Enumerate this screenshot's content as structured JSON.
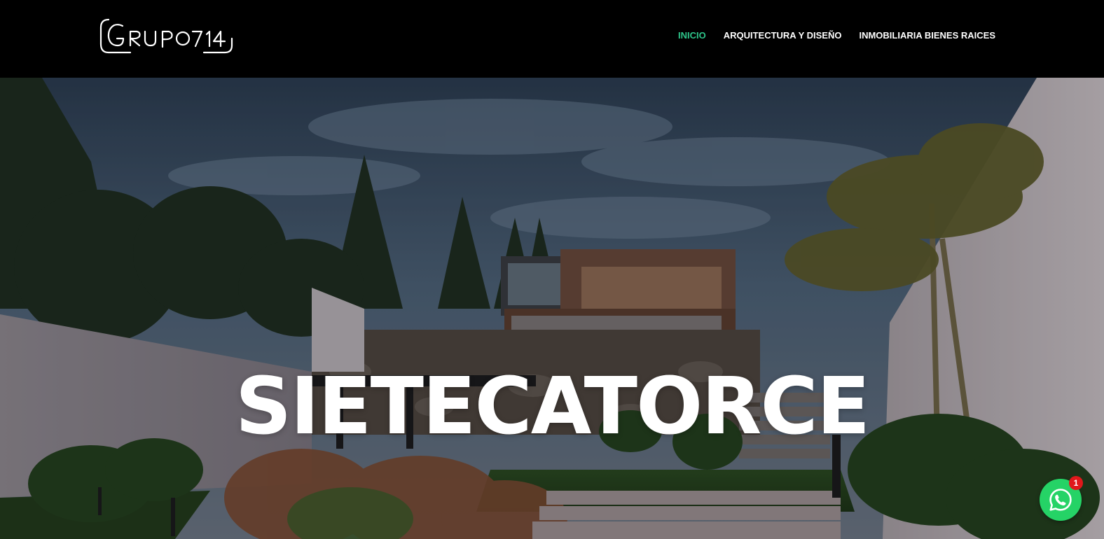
{
  "brand": {
    "logo_text": "GRUPO714"
  },
  "nav": {
    "items": [
      {
        "label": "INICIO",
        "active": true
      },
      {
        "label": "ARQUITECTURA Y DISEÑO",
        "active": false
      },
      {
        "label": "INMOBILIARIA BIENES RAICES",
        "active": false
      }
    ]
  },
  "hero": {
    "title": "SIETECATORCE"
  },
  "whatsapp": {
    "icon": "whatsapp-icon",
    "badge_count": "1"
  },
  "colors": {
    "header_bg": "#000000",
    "nav_active": "#2ec58a",
    "nav_text": "#ffffff",
    "whatsapp_green": "#25d366",
    "badge_red": "#e0181b"
  }
}
